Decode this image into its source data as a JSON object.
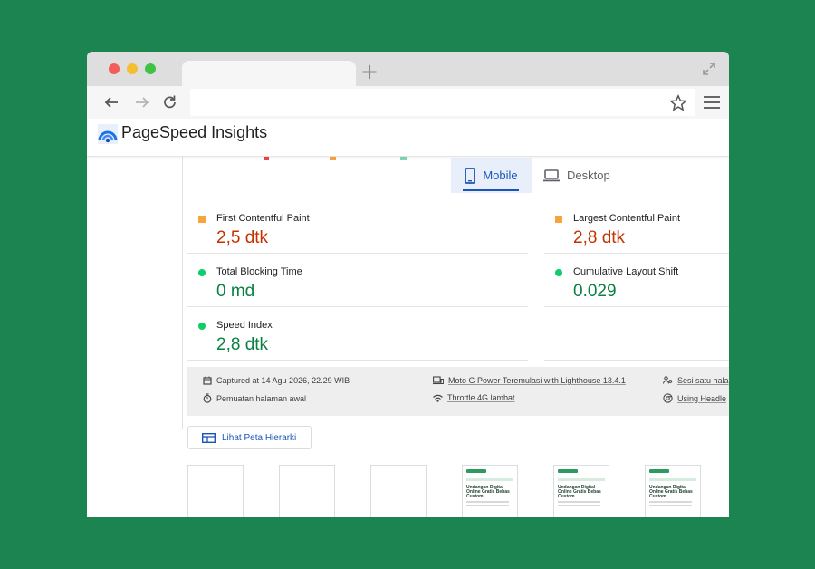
{
  "browser": {
    "new_tab_symbol": "+",
    "icons": [
      "back-arrow-icon",
      "forward-arrow-icon",
      "reload-icon",
      "star-icon",
      "hamburger-menu-icon",
      "expand-icon"
    ]
  },
  "header": {
    "title": "PageSpeed Insights"
  },
  "device_tabs": {
    "mobile": "Mobile",
    "desktop": "Desktop",
    "active": "mobile"
  },
  "metrics": {
    "fcp": {
      "label": "First Contentful Paint",
      "value": "2,5 dtk",
      "status": "average"
    },
    "lcp": {
      "label": "Largest Contentful Paint",
      "value": "2,8 dtk",
      "status": "average"
    },
    "tbt": {
      "label": "Total Blocking Time",
      "value": "0 md",
      "status": "good"
    },
    "cls": {
      "label": "Cumulative Layout Shift",
      "value": "0.029",
      "status": "good"
    },
    "si": {
      "label": "Speed Index",
      "value": "2,8 dtk",
      "status": "good"
    }
  },
  "info": {
    "captured": "Captured at 14 Agu 2026, 22.29 WIB",
    "load": "Pemuatan halaman awal",
    "device": "Moto G Power Teremulasi with Lighthouse 13.4.1",
    "throttle": "Throttle 4G lambat",
    "session": "Sesi satu hala",
    "browser": "Using Headle"
  },
  "treemap_button": "Lihat Peta Hierarki",
  "thumbnail_title": "Undangan Digital Online Gratis Bebas Custom",
  "colors": {
    "background": "#1b8450",
    "average": "#f7a33e",
    "average_text": "#c33300",
    "good": "#0cce6b",
    "good_text": "#0b8043",
    "link": "#1a55b8"
  }
}
